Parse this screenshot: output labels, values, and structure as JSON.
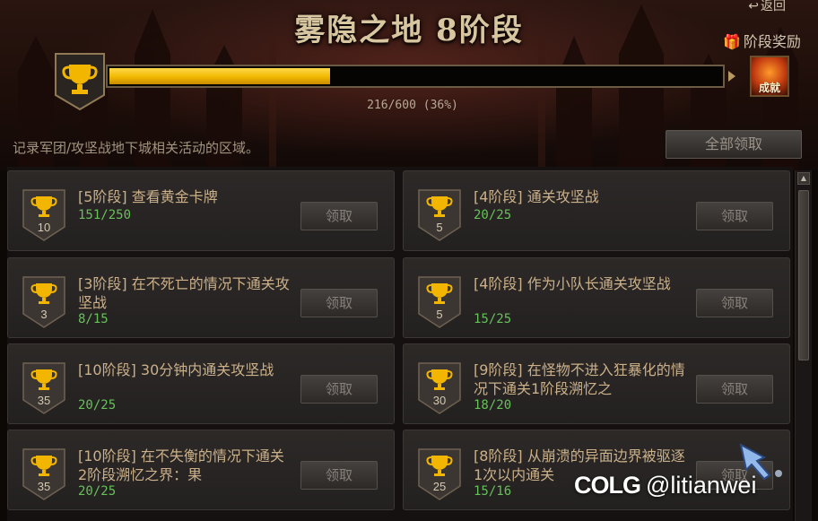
{
  "header": {
    "title": "雾隐之地 8阶段",
    "return_label": "返回",
    "stage_reward_label": "阶段奖励",
    "reward_icon_text": "成就"
  },
  "progress": {
    "text": "216/600 (36%)",
    "fraction": 0.36
  },
  "description": "记录军团/攻坚战地下城相关活动的区域。",
  "claim_all_label": "全部领取",
  "tasks": [
    {
      "points": "10",
      "title": "[5阶段] 查看黄金卡牌",
      "progress": "151/250",
      "button": "领取"
    },
    {
      "points": "5",
      "title": "[4阶段] 通关攻坚战",
      "progress": "20/25",
      "button": "领取"
    },
    {
      "points": "3",
      "title": "[3阶段] 在不死亡的情况下通关攻坚战",
      "progress": "8/15",
      "button": "领取"
    },
    {
      "points": "5",
      "title": "[4阶段] 作为小队长通关攻坚战",
      "progress": "15/25",
      "button": "领取"
    },
    {
      "points": "35",
      "title": "[10阶段] 30分钟内通关攻坚战",
      "progress": "20/25",
      "button": "领取"
    },
    {
      "points": "30",
      "title": "[9阶段] 在怪物不进入狂暴化的情况下通关1阶段溯忆之",
      "progress": "18/20",
      "button": "领取"
    },
    {
      "points": "35",
      "title": "[10阶段] 在不失衡的情况下通关2阶段溯忆之界：果",
      "progress": "20/25",
      "button": "领取"
    },
    {
      "points": "25",
      "title": "[8阶段] 从崩溃的异面边界被驱逐1次以内通关",
      "progress": "15/16",
      "button": "领取"
    }
  ],
  "watermark": {
    "logo": "COLG",
    "handle": "@litianwei"
  },
  "colors": {
    "progress_fill": "#f1b800",
    "progress_text_green": "#67c15a",
    "task_title": "#cbb08a"
  }
}
